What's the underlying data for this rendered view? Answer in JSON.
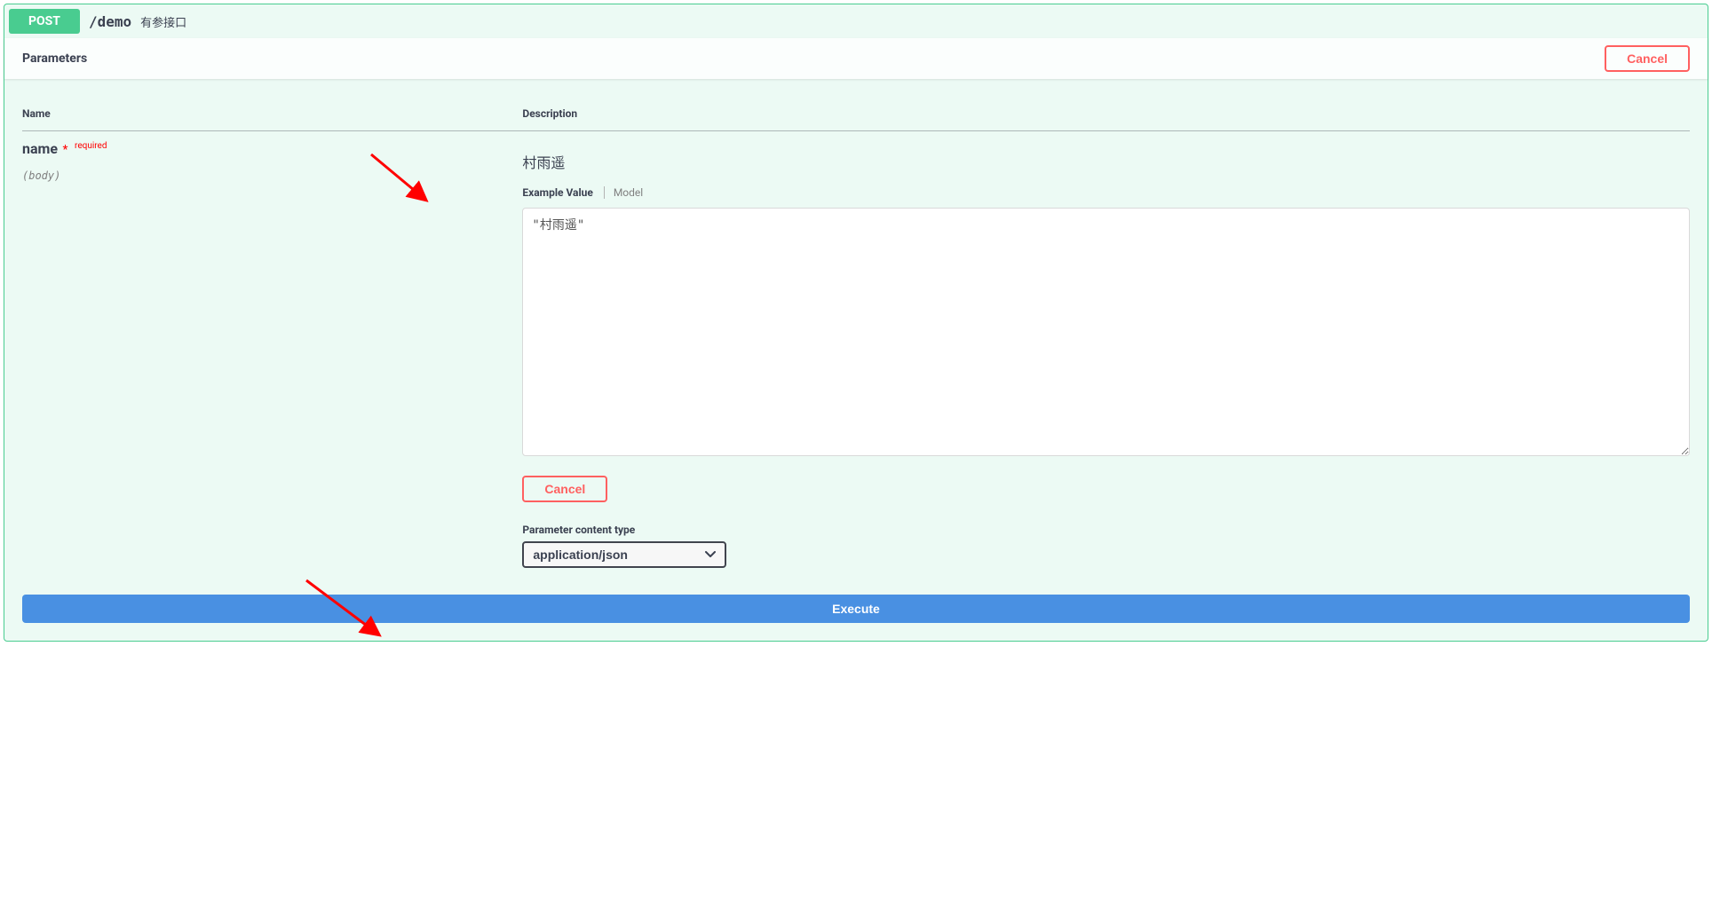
{
  "opblock": {
    "method": "POST",
    "path": "/demo",
    "description": "有参接口"
  },
  "section": {
    "title": "Parameters",
    "cancel_label": "Cancel"
  },
  "table": {
    "header_name": "Name",
    "header_description": "Description"
  },
  "param": {
    "name": "name",
    "required_label": "required",
    "in": "(body)",
    "description": "村雨遥",
    "tab_example": "Example Value",
    "tab_model": "Model",
    "body_value": "\"村雨遥\"",
    "cancel_label": "Cancel",
    "content_type_label": "Parameter content type",
    "content_type_value": "application/json"
  },
  "execute": {
    "label": "Execute"
  }
}
